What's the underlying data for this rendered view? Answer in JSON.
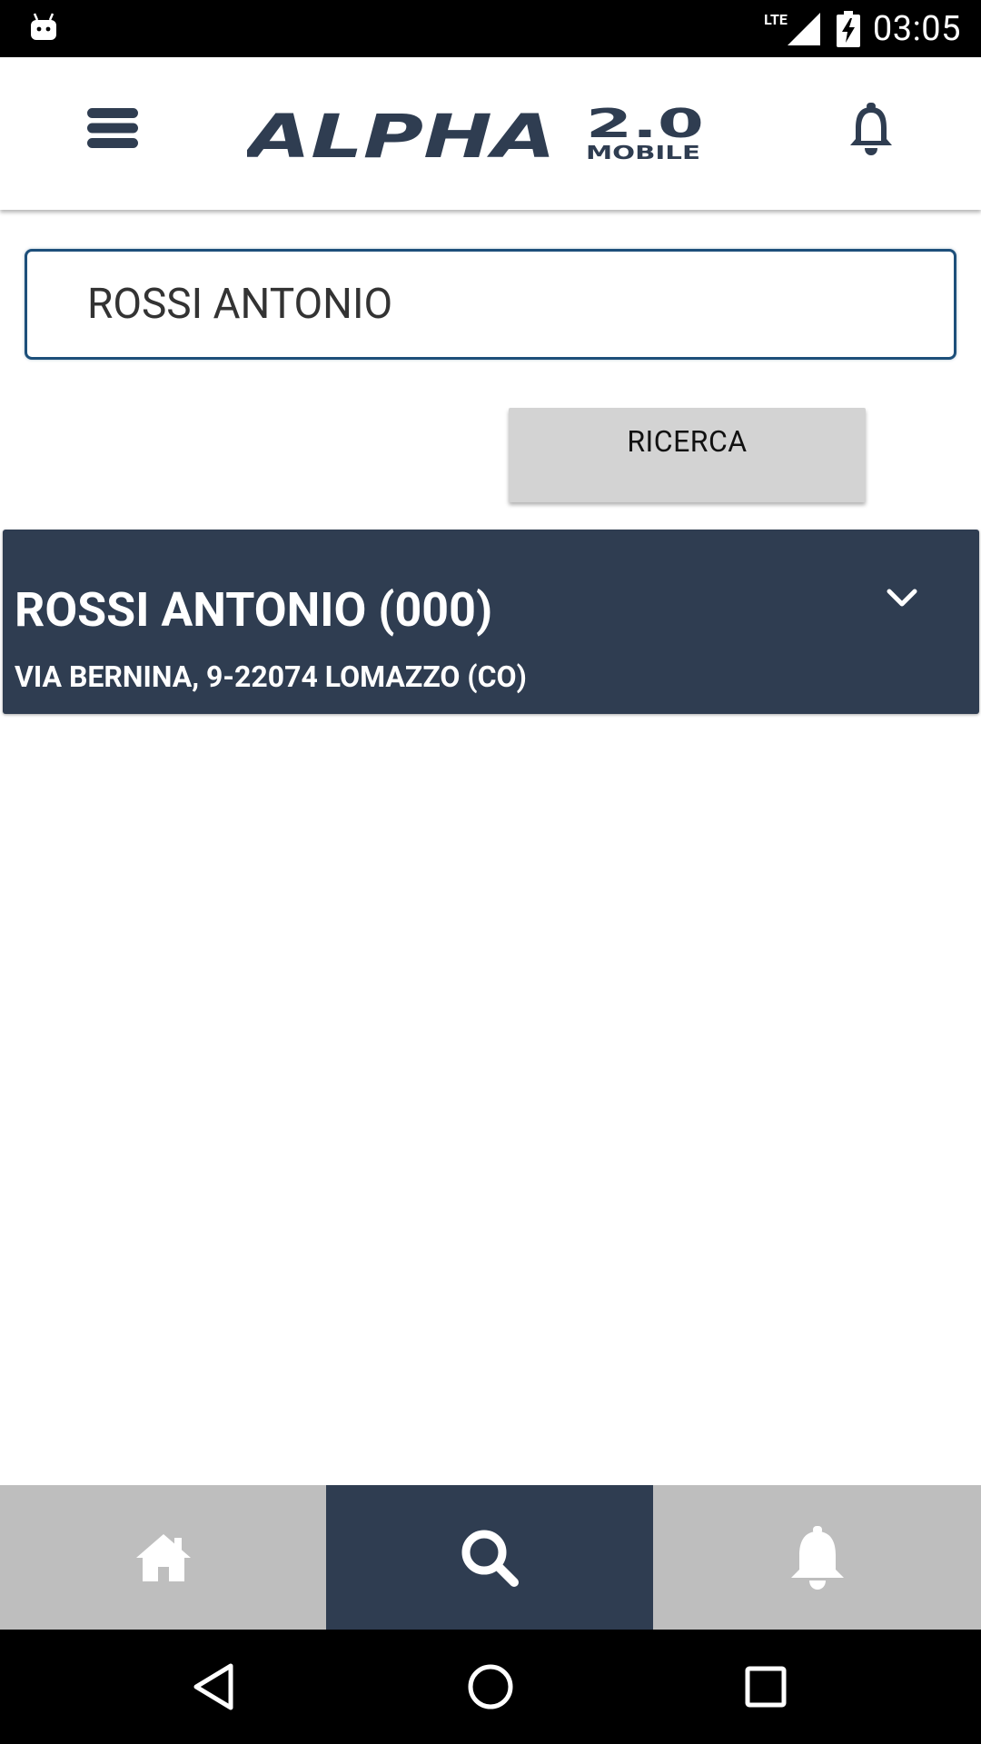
{
  "status_bar": {
    "network_label": "LTE",
    "clock": "03:05",
    "icons": [
      "android-debug-icon",
      "signal-icon",
      "battery-charging-icon"
    ]
  },
  "header": {
    "logo_text": "ALPHA 2.0",
    "logo_subtext": "MOBILE",
    "icons": [
      "menu-icon",
      "bell-icon"
    ]
  },
  "search": {
    "value": "ROSSI ANTONIO",
    "button_label": "RICERCA"
  },
  "results": [
    {
      "name": "ROSSI ANTONIO (000)",
      "address": "VIA BERNINA, 9-22074 LOMAZZO (CO)",
      "icon": "chevron-down-icon"
    }
  ],
  "bottom_nav": {
    "tabs": [
      {
        "icon": "home-icon",
        "active": false
      },
      {
        "icon": "search-icon",
        "active": true
      },
      {
        "icon": "bell-icon",
        "active": false
      }
    ]
  },
  "colors": {
    "primary_dark": "#2f3d51",
    "input_border": "#1d4f7a",
    "button_gray": "#d3d3d3",
    "nav_gray": "#bebebe"
  }
}
